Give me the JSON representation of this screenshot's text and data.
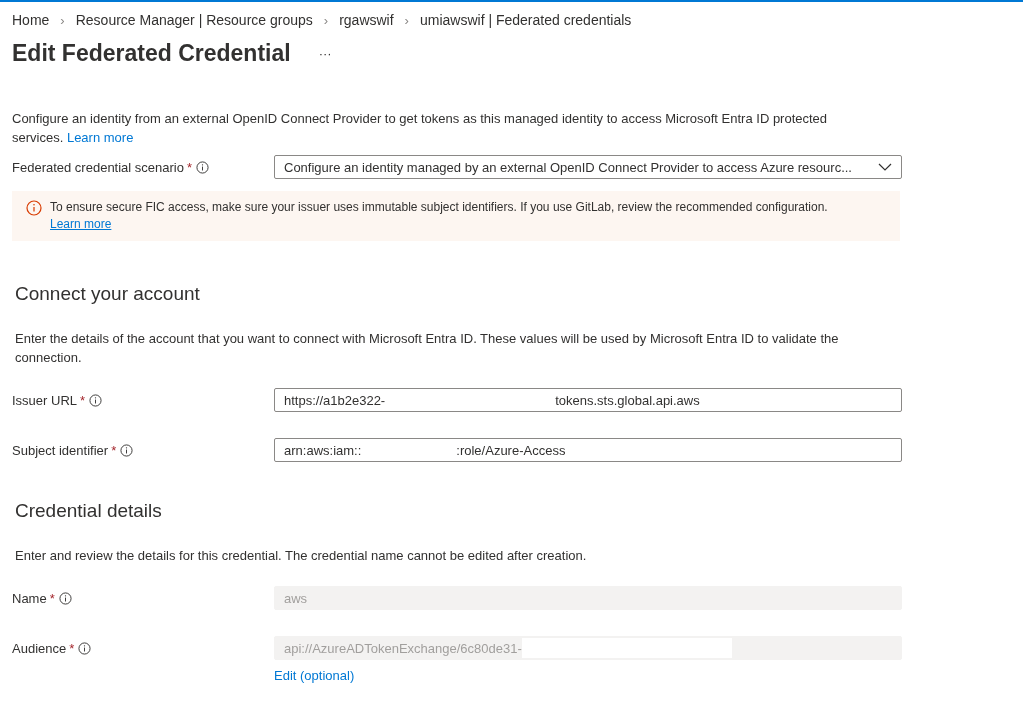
{
  "breadcrumb": [
    "Home",
    "Resource Manager | Resource groups",
    "rgawswif",
    "umiawswif | Federated credentials"
  ],
  "breadcrumb_separator": "›",
  "title": "Edit Federated Credential",
  "more": "···",
  "intro": {
    "text": "Configure an identity from an external OpenID Connect Provider to get tokens as this managed identity to access Microsoft Entra ID protected services.",
    "link": "Learn more"
  },
  "scenario": {
    "label": "Federated credential scenario",
    "required_mark": "*",
    "kind": "dropdown",
    "value_start": "Configure an identity managed by an external OpenID Connect Provider to access Azure resourc..."
  },
  "warning": {
    "text": "To ensure secure FIC access, make sure your issuer uses immutable subject identifiers. If you use GitLab, review the recommended configuration.",
    "link": "Learn more"
  },
  "sections": [
    {
      "heading": "Connect your account",
      "description": "Enter the details of the account that you want to connect with Microsoft Entra ID. These values will be used by Microsoft Entra ID to validate the connection.",
      "fields": [
        {
          "label": "Issuer URL",
          "required_mark": "*",
          "kind": "text",
          "value_start": "https://a1b2e322-",
          "value_end": "tokens.sts.global.api.aws",
          "disabled": false
        },
        {
          "label": "Subject identifier",
          "required_mark": "*",
          "kind": "text",
          "value_start": "arn:aws:iam::",
          "value_end": ":role/Azure-Access",
          "disabled": false
        }
      ]
    },
    {
      "heading": "Credential details",
      "description": "Enter and review the details for this credential. The credential name cannot be edited after creation.",
      "fields": [
        {
          "label": "Name",
          "required_mark": "*",
          "kind": "text",
          "value_start": "aws",
          "disabled": true,
          "redacted": false
        },
        {
          "label": "Audience",
          "required_mark": "*",
          "kind": "text",
          "value_start": "api://AzureADTokenExchange/6c80de31-",
          "disabled": true,
          "redacted": true,
          "link": "Edit (optional)"
        }
      ]
    }
  ]
}
